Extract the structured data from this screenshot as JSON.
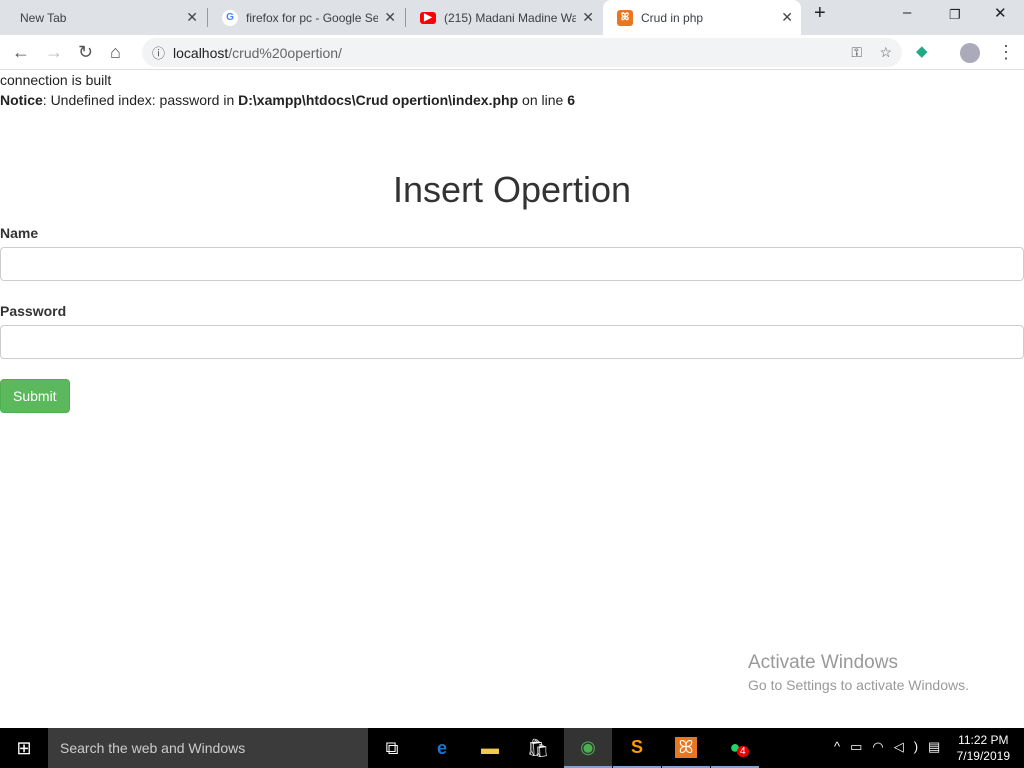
{
  "browser": {
    "tabs": [
      {
        "title": "New Tab",
        "icon": "none"
      },
      {
        "title": "firefox for pc - Google Se",
        "icon": "google-icon"
      },
      {
        "title": "(215) Madani Madine Wa",
        "icon": "youtube-icon"
      },
      {
        "title": "Crud in php",
        "icon": "xampp-icon",
        "active": true
      }
    ],
    "url_host": "localhost",
    "url_path": "/crud%20opertion/"
  },
  "page": {
    "line1": "connection is built",
    "notice_label": "Notice",
    "notice_text": ": Undefined index: password in ",
    "notice_path": "D:\\xampp\\htdocs\\Crud opertion\\index.php",
    "notice_online": " on line ",
    "notice_line": "6",
    "heading": "Insert Opertion",
    "name_label": "Name",
    "name_value": "",
    "password_label": "Password",
    "password_value": "",
    "submit": "Submit"
  },
  "watermark": {
    "title": "Activate Windows",
    "sub": "Go to Settings to activate Windows."
  },
  "taskbar": {
    "search_placeholder": "Search the web and Windows",
    "time": "11:22 PM",
    "date": "7/19/2019",
    "whatsapp_badge": "4"
  },
  "colors": {
    "submit": "#5cb85c"
  }
}
